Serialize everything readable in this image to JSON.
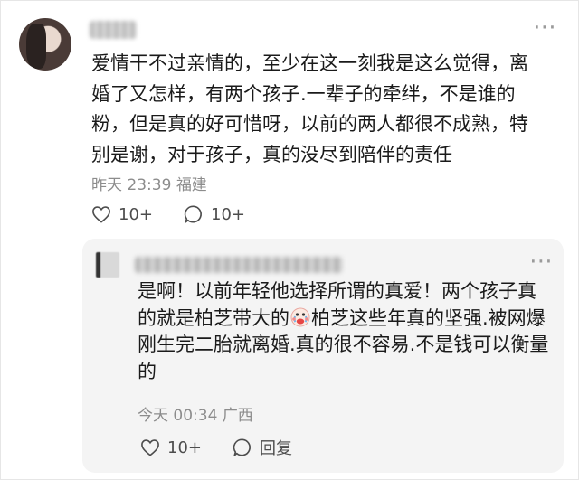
{
  "comment": {
    "text": "爱情干不过亲情的，至少在这一刻我是这么觉得，离婚了又怎样，有两个孩子.一辈子的牵绊，不是谁的粉，但是真的好可惜呀，以前的两人都很不成熟，特别是谢，对于孩子，真的没尽到陪伴的责任",
    "time": "昨天 23:39",
    "location": "福建",
    "like_count": "10+",
    "reply_count": "10+"
  },
  "reply": {
    "text_before_emoji": "是啊！以前年轻他选择所谓的真爱！两个孩子真的就是柏芝带大的",
    "emoji": "crying-face-emoji",
    "text_after_emoji": "柏芝这些年真的坚强.被网爆刚生完二胎就离婚.真的很不容易.不是钱可以衡量的",
    "time": "今天 00:34",
    "location": "广西",
    "like_count": "10+",
    "reply_label": "回复"
  }
}
